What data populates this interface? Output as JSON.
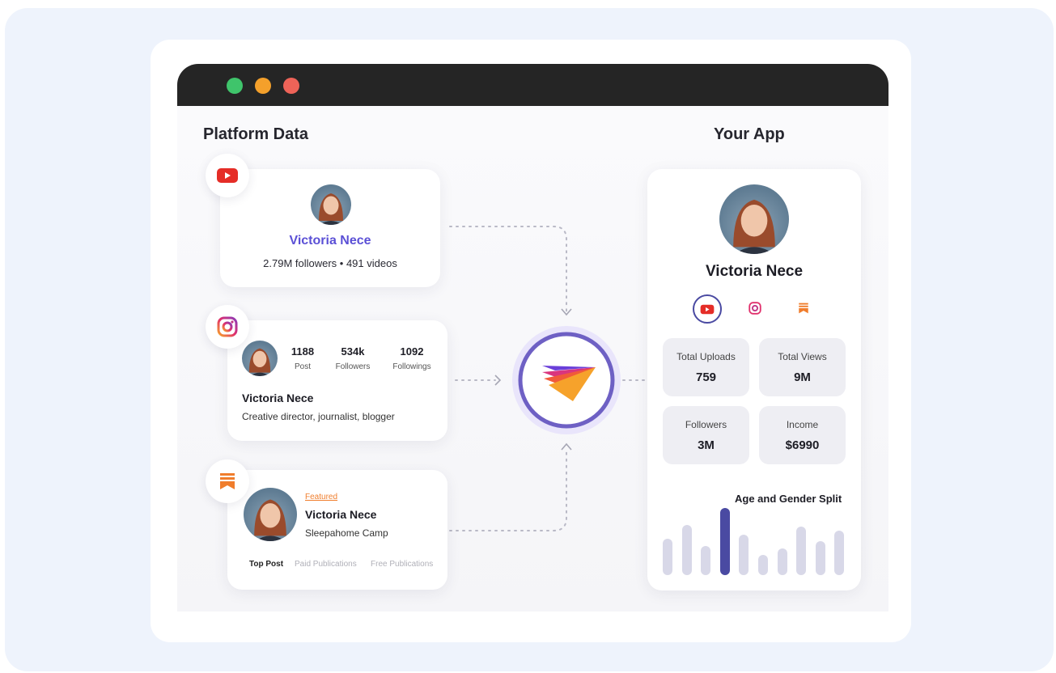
{
  "window": {
    "left_title": "Platform Data",
    "right_title": "Your App"
  },
  "youtube_card": {
    "name": "Victoria Nece",
    "stats": "2.79M followers  •  491 videos"
  },
  "instagram_card": {
    "metrics": [
      {
        "value": "1188",
        "label": "Post"
      },
      {
        "value": "534k",
        "label": "Followers"
      },
      {
        "value": "1092",
        "label": "Followings"
      }
    ],
    "name": "Victoria Nece",
    "bio": "Creative director, journalist, blogger"
  },
  "substack_card": {
    "tag": "Featured",
    "name": "Victoria Nece",
    "subtitle": "Sleepahome Camp",
    "tabs": [
      "Top Post",
      "Paid Publications",
      "Free Publications"
    ]
  },
  "app_card": {
    "name": "Victoria Nece",
    "social_icons": [
      "youtube-icon",
      "instagram-icon",
      "substack-icon"
    ],
    "stats": [
      {
        "label": "Total Uploads",
        "value": "759"
      },
      {
        "label": "Total Views",
        "value": "9M"
      },
      {
        "label": "Followers",
        "value": "3M"
      },
      {
        "label": "Income",
        "value": "$6990"
      }
    ],
    "chart_title": "Age and Gender Split"
  },
  "chart_data": {
    "type": "bar",
    "title": "Age and Gender Split",
    "values": [
      0.47,
      0.65,
      0.38,
      0.87,
      0.53,
      0.26,
      0.35,
      0.63,
      0.44,
      0.58
    ],
    "highlight_index": 3
  },
  "colors": {
    "accent": "#5b50d6",
    "youtube": "#e52d27",
    "substack": "#f07d2c",
    "bar": "#d8d8e8",
    "bar_highlight": "#4a4aa2"
  }
}
